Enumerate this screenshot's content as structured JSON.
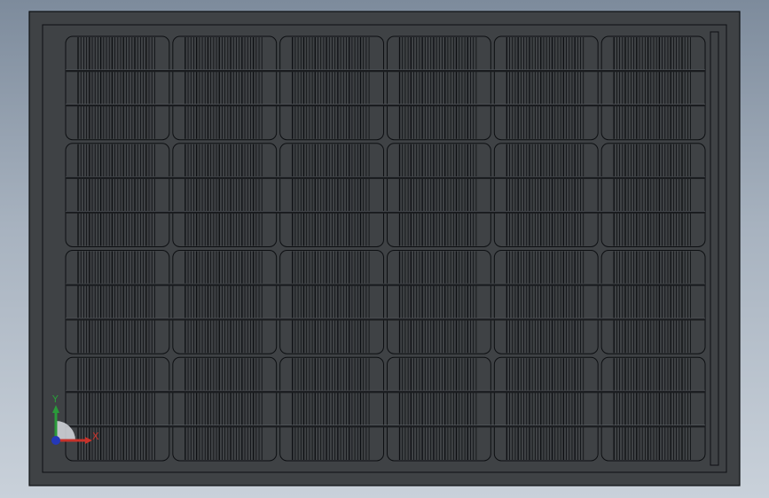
{
  "viewport": {
    "background_top": "#7d8b9c",
    "background_bottom": "#c9d1da"
  },
  "model": {
    "name": "solar-panel",
    "frame_color": "#3f4245",
    "edge_color": "#0d0f12",
    "cell_columns": 6,
    "cell_rows": 4,
    "busbars_per_row": 2
  },
  "triad": {
    "x_label": "X",
    "y_label": "Y",
    "x_color": "#c8322a",
    "y_color": "#2a9a3a",
    "z_color": "#2438b8"
  }
}
